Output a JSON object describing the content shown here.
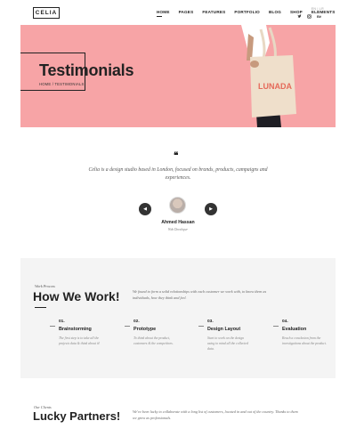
{
  "header": {
    "logo": "CELIA",
    "nav": [
      {
        "label": "HOME"
      },
      {
        "label": "PAGES"
      },
      {
        "label": "FEATURES"
      },
      {
        "label": "PORTFOLIO"
      },
      {
        "label": "BLOG"
      },
      {
        "label": "SHOP"
      },
      {
        "label": "ELEMENTS"
      }
    ],
    "lang": "EN  |  LR",
    "social": [
      "twitter-icon",
      "instagram-icon",
      "behance-icon"
    ]
  },
  "hero": {
    "title": "Testimonials",
    "breadcrumb": "HOME / TESTIMONIALS",
    "bag_text": "LUNADA",
    "bg_color": "#f7a4a6"
  },
  "testimonial": {
    "text": "Celia is a design studio based in London, focused on brands, products, campaigns and experiences.",
    "author": "Ahmed Hassan",
    "role": "Web Developer"
  },
  "work": {
    "kicker": "Work Process",
    "title": "How We Work!",
    "description": "We found to form a solid relationships with each customer we work with, to know them as individuals, how they think and feel.",
    "steps": [
      {
        "num": "01.",
        "title": "Brainstorming",
        "text": "The first step is to take all the projects data & think about it!"
      },
      {
        "num": "02.",
        "title": "Prototype",
        "text": "To think about the product, customers & the competitors."
      },
      {
        "num": "03.",
        "title": "Design Layout",
        "text": "Start to work on the design using to mind all the collected data."
      },
      {
        "num": "04.",
        "title": "Evaluation",
        "text": "Reach a conclusion from the investigations about the product."
      }
    ]
  },
  "partners": {
    "kicker": "Our Clients",
    "title": "Lucky Partners!",
    "description": "We've been lucky to collaborate with a long list of customers, located in and out of the country. Thanks to them we grow as professionals."
  }
}
